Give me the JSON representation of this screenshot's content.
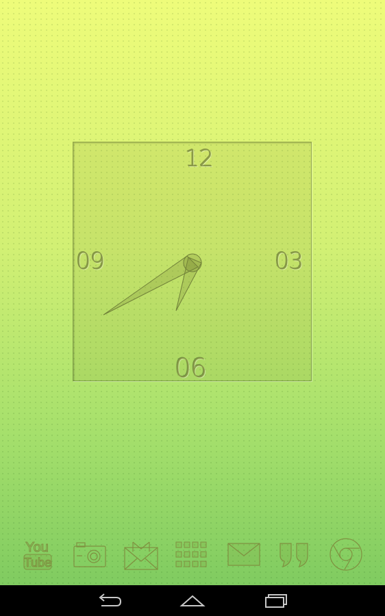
{
  "clock": {
    "n12": "12",
    "n03": "03",
    "n06": "06",
    "n09": "09"
  },
  "dock": {
    "youtube_line1": "You",
    "youtube_line2": "Tube",
    "icons": [
      "youtube-icon",
      "camera-icon",
      "gmail-icon",
      "app-drawer-icon",
      "email-icon",
      "hangouts-icon",
      "chrome-icon"
    ]
  },
  "navbar": {
    "buttons": [
      "back-icon",
      "home-icon",
      "recent-apps-icon"
    ]
  },
  "colors": {
    "background_top": "#eefc7a",
    "background_bottom": "#78c75e",
    "icon_embossed": "#8a9a48",
    "navbar": "#000000"
  }
}
